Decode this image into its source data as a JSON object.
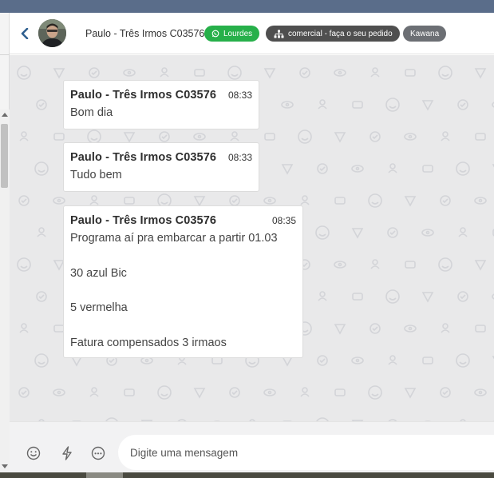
{
  "header": {
    "back_icon": "chevron-left-icon",
    "contact_name": "Paulo - Três Irmos C03576",
    "tags": [
      {
        "label": "Lourdes",
        "icon": "whatsapp-icon",
        "color": "#27b04a"
      },
      {
        "label": "comercial - faça o seu pedido",
        "icon": "sitemap-icon",
        "color": "#4f4f4f"
      },
      {
        "label": "Kawana",
        "color": "#6c6f74"
      }
    ]
  },
  "messages": [
    {
      "author": "Paulo - Três Irmos C03576",
      "time": "08:33",
      "text": "Bom dia"
    },
    {
      "author": "Paulo - Três Irmos C03576",
      "time": "08:33",
      "text": "Tudo bem"
    },
    {
      "author": "Paulo - Três Irmos C03576",
      "time": "08:35",
      "text": "Programa aí pra embarcar a partir 01.03\n\n30 azul Bic\n\n5 vermelha\n\nFatura compensados 3 irmaos"
    }
  ],
  "composer": {
    "placeholder": "Digite uma mensagem",
    "icons": [
      "emoji-icon",
      "lightning-icon",
      "more-dots-icon"
    ]
  },
  "colors": {
    "chat_background": "#e9e9ea",
    "top_strip": "#5a6d8a",
    "tag_green": "#27b04a"
  }
}
